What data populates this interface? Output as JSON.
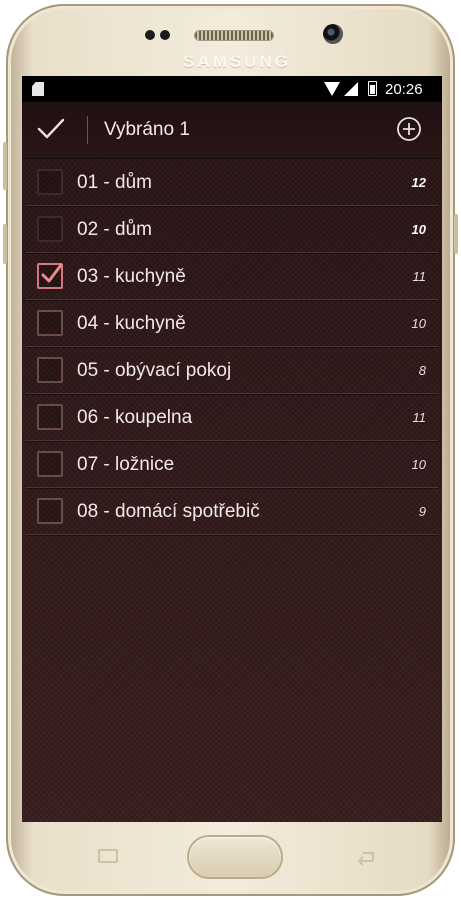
{
  "device": {
    "brand": "SAMSUNG"
  },
  "status_bar": {
    "time": "20:26",
    "icons": [
      "sd-card-icon",
      "wifi-icon",
      "signal-icon",
      "battery-icon"
    ]
  },
  "action_bar": {
    "title": "Vybráno 1",
    "icons": [
      "check-icon",
      "add-circle-icon"
    ]
  },
  "list": {
    "items": [
      {
        "label": "01 - dům",
        "count": "12",
        "checked": false
      },
      {
        "label": "02 - dům",
        "count": "10",
        "checked": false
      },
      {
        "label": "03 - kuchyně",
        "count": "11",
        "checked": true
      },
      {
        "label": "04 - kuchyně",
        "count": "10",
        "checked": false
      },
      {
        "label": "05 - obývací pokoj",
        "count": "8",
        "checked": false
      },
      {
        "label": "06 - koupelna",
        "count": "11",
        "checked": false
      },
      {
        "label": "07 - ložnice",
        "count": "10",
        "checked": false
      },
      {
        "label": "08 - domácí spotřebič",
        "count": "9",
        "checked": false
      }
    ]
  },
  "colors": {
    "background": "#2b1718",
    "accent": "#d07a7f",
    "phone_frame": "#e9dfca"
  }
}
